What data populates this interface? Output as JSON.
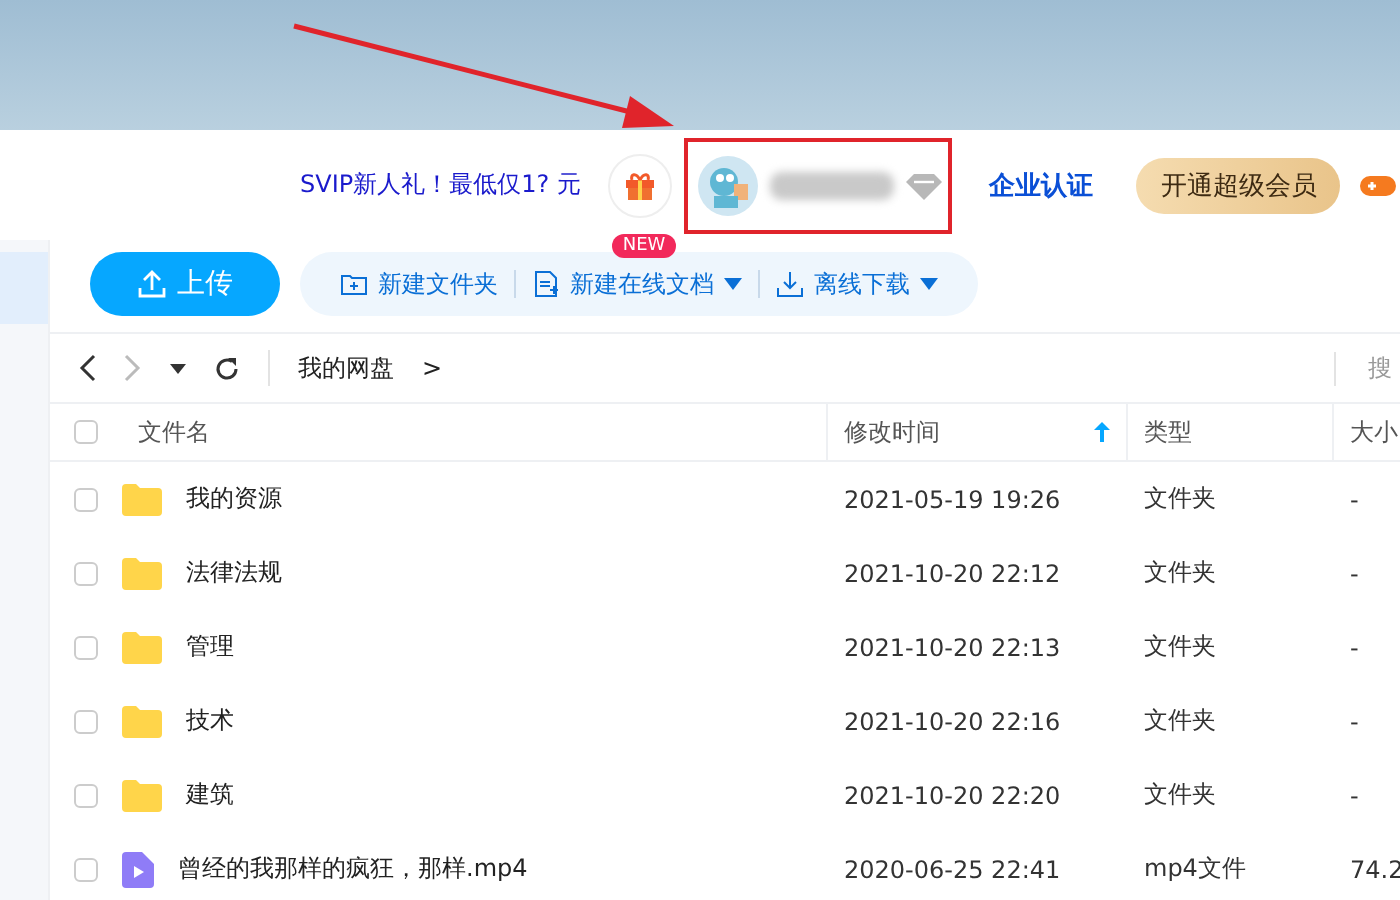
{
  "header": {
    "promo": "SVIP新人礼！最低仅1? 元",
    "enterprise_link": "企业认证",
    "upgrade_button": "开通超级会员"
  },
  "toolbar": {
    "upload": "上传",
    "actions": [
      {
        "label": "新建文件夹",
        "dropdown": false
      },
      {
        "label": "新建在线文档",
        "dropdown": true,
        "badge": "NEW"
      },
      {
        "label": "离线下载",
        "dropdown": true
      }
    ]
  },
  "nav": {
    "breadcrumb": "我的网盘",
    "separator": ">",
    "search": {
      "placeholder": "搜"
    }
  },
  "table": {
    "select_all": {
      "checked": false
    },
    "columns": [
      {
        "label": "文件名",
        "sorted": false
      },
      {
        "label": "修改时间",
        "sorted": true
      },
      {
        "label": "类型",
        "sorted": false
      },
      {
        "label": "大小",
        "sorted": false
      }
    ],
    "rows": [
      {
        "kind": "folder",
        "name": "我的资源",
        "modified": "2021-05-19 19:26",
        "type": "文件夹",
        "size": "-",
        "checked": false
      },
      {
        "kind": "folder",
        "name": "法律法规",
        "modified": "2021-10-20 22:12",
        "type": "文件夹",
        "size": "-",
        "checked": false
      },
      {
        "kind": "folder",
        "name": "管理",
        "modified": "2021-10-20 22:13",
        "type": "文件夹",
        "size": "-",
        "checked": false
      },
      {
        "kind": "folder",
        "name": "技术",
        "modified": "2021-10-20 22:16",
        "type": "文件夹",
        "size": "-",
        "checked": false
      },
      {
        "kind": "folder",
        "name": "建筑",
        "modified": "2021-10-20 22:20",
        "type": "文件夹",
        "size": "-",
        "checked": false
      },
      {
        "kind": "video",
        "name": "曾经的我那样的疯狂，那样.mp4",
        "modified": "2020-06-25 22:41",
        "type": "mp4文件",
        "size": "74.2",
        "checked": false
      }
    ]
  }
}
